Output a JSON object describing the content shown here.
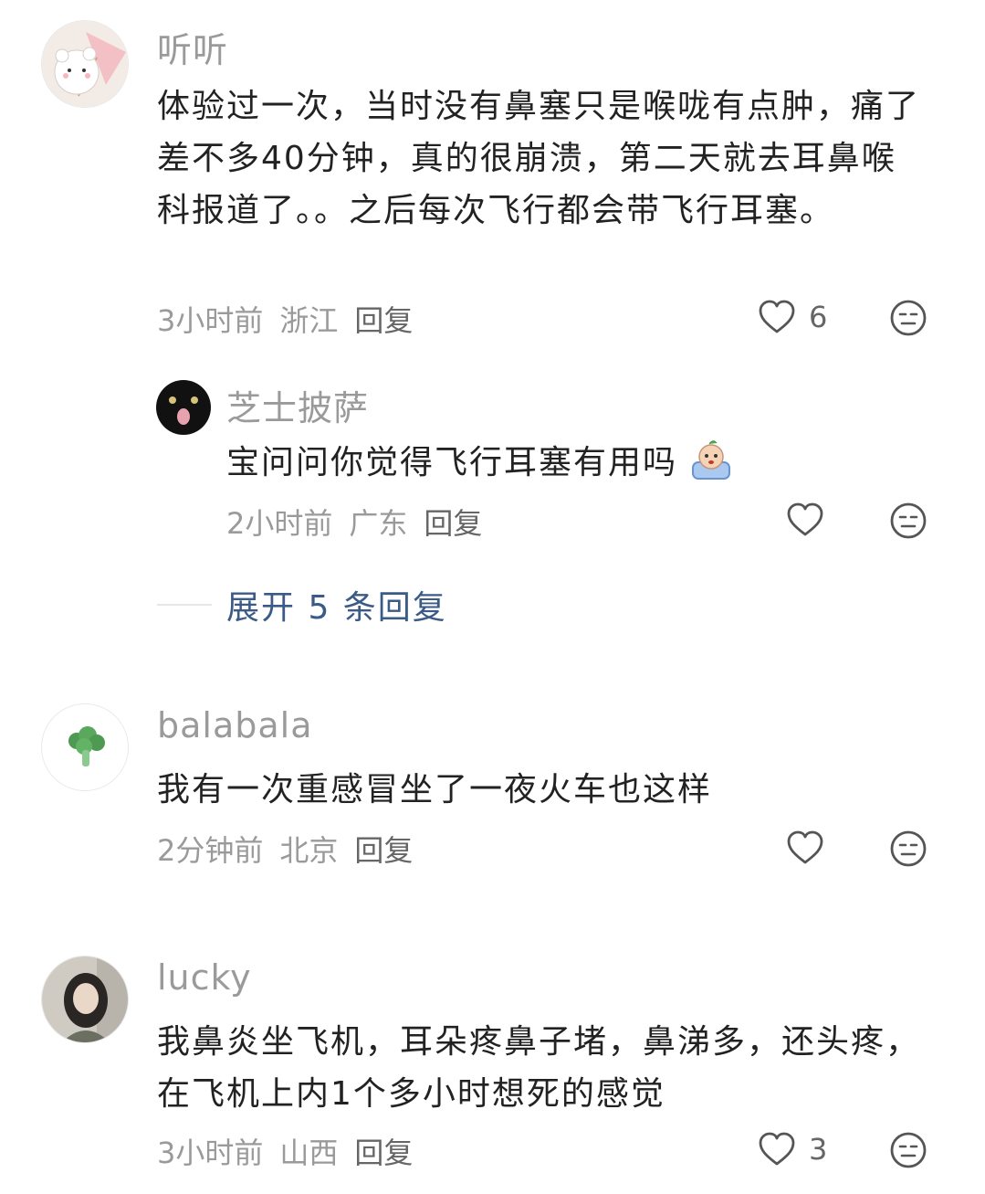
{
  "comments": [
    {
      "user": "听听",
      "text": "体验过一次，当时没有鼻塞只是喉咙有点肿，痛了差不多40分钟，真的很崩溃，第二天就去耳鼻喉科报道了。。之后每次飞行都会带飞行耳塞。",
      "time": "3小时前",
      "location": "浙江",
      "reply_label": "回复",
      "likes": "6",
      "avatar_icon": "bear-umbrella-avatar"
    },
    {
      "user": "balabala",
      "text": "我有一次重感冒坐了一夜火车也这样",
      "time": "2分钟前",
      "location": "北京",
      "reply_label": "回复",
      "likes": "",
      "avatar_icon": "broccoli-avatar"
    },
    {
      "user": "lucky",
      "text": "我鼻炎坐飞机，耳朵疼鼻子堵，鼻涕多，还头疼，在飞机上内1个多小时想死的感觉",
      "time": "3小时前",
      "location": "山西",
      "reply_label": "回复",
      "likes": "3",
      "avatar_icon": "girl-photo-avatar"
    }
  ],
  "reply": {
    "user": "芝士披萨",
    "text": "宝问问你觉得飞行耳塞有用吗",
    "emoji": "crying-face-emoji",
    "time": "2小时前",
    "location": "广东",
    "reply_label": "回复",
    "likes": "",
    "avatar_icon": "black-cat-avatar"
  },
  "expand": {
    "label": "展开 5 条回复"
  },
  "colors": {
    "meta": "#9a9a9a",
    "expand_link": "#3a5a88",
    "text": "#222222"
  }
}
